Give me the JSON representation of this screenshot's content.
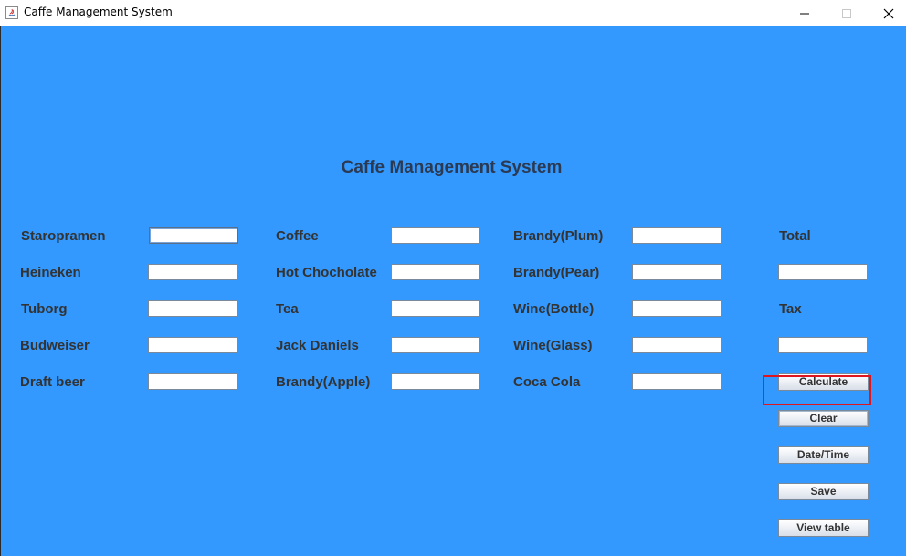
{
  "window": {
    "title": "Caffe Management System",
    "controls": [
      "minimize-icon",
      "maximize-icon",
      "close-icon"
    ]
  },
  "heading": "Caffe Management System",
  "columns": {
    "beers": [
      {
        "label": "Staropramen",
        "value": ""
      },
      {
        "label": "Heineken",
        "value": ""
      },
      {
        "label": "Tuborg",
        "value": ""
      },
      {
        "label": "Budweiser",
        "value": ""
      },
      {
        "label": "Draft beer",
        "value": ""
      }
    ],
    "drinks": [
      {
        "label": "Coffee",
        "value": ""
      },
      {
        "label": "Hot Chocholate",
        "value": ""
      },
      {
        "label": "Tea",
        "value": ""
      },
      {
        "label": "Jack Daniels",
        "value": ""
      },
      {
        "label": "Brandy(Apple)",
        "value": ""
      }
    ],
    "spirits": [
      {
        "label": "Brandy(Plum)",
        "value": ""
      },
      {
        "label": "Brandy(Pear)",
        "value": ""
      },
      {
        "label": "Wine(Bottle)",
        "value": ""
      },
      {
        "label": "Wine(Glass)",
        "value": ""
      },
      {
        "label": "Coca Cola",
        "value": ""
      }
    ]
  },
  "summary": {
    "total_label": "Total",
    "total_value": "",
    "tax_label": "Tax",
    "tax_value": ""
  },
  "buttons": {
    "calculate": "Calculate",
    "clear": "Clear",
    "datetime": "Date/Time",
    "save": "Save",
    "view_table": "View table"
  },
  "colors": {
    "background": "#3399ff",
    "highlight": "#e0161e"
  }
}
